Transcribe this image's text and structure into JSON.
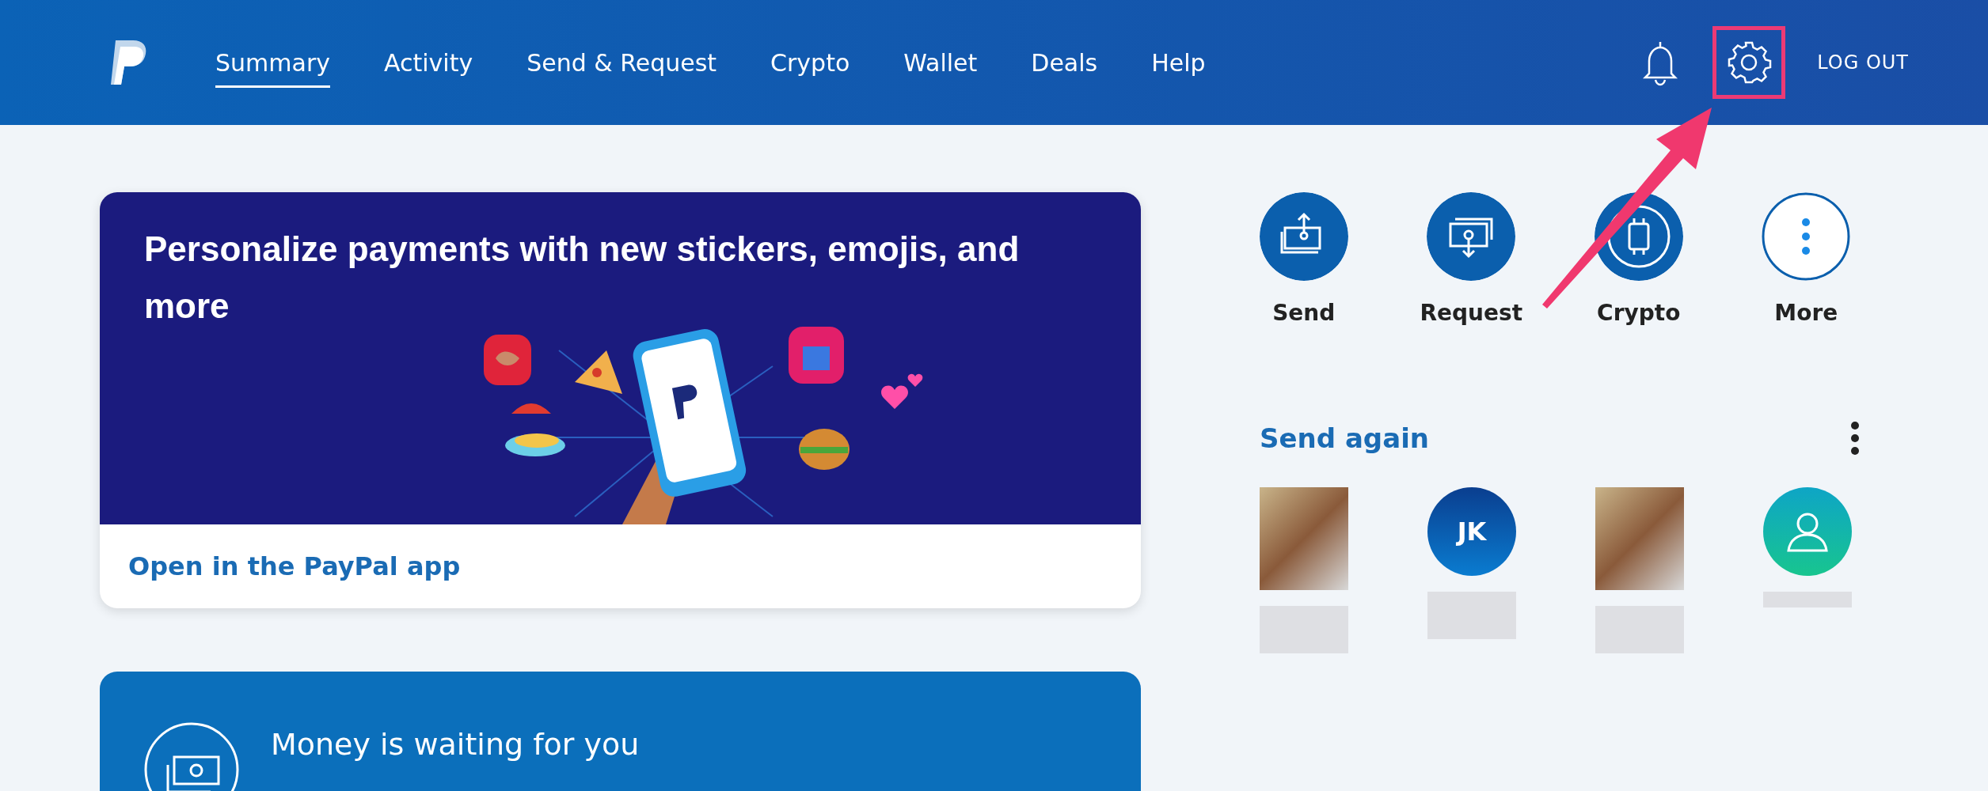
{
  "header": {
    "nav": [
      {
        "label": "Summary",
        "selected": true
      },
      {
        "label": "Activity",
        "selected": false
      },
      {
        "label": "Send & Request",
        "selected": false
      },
      {
        "label": "Crypto",
        "selected": false
      },
      {
        "label": "Wallet",
        "selected": false
      },
      {
        "label": "Deals",
        "selected": false
      },
      {
        "label": "Help",
        "selected": false
      }
    ],
    "settings_highlighted": true,
    "logout": "LOG OUT"
  },
  "promo_card": {
    "title": "Personalize payments with new stickers, emojis, and more",
    "link": "Open in the PayPal app"
  },
  "money_card": {
    "title": "Money is waiting for you"
  },
  "actions": [
    {
      "kind": "send",
      "label": "Send"
    },
    {
      "kind": "request",
      "label": "Request"
    },
    {
      "kind": "crypto",
      "label": "Crypto"
    },
    {
      "kind": "more",
      "label": "More"
    }
  ],
  "send_again": {
    "title": "Send again",
    "contacts": [
      {
        "kind": "photo"
      },
      {
        "kind": "initials",
        "initials": "JK"
      },
      {
        "kind": "photo"
      },
      {
        "kind": "generic"
      }
    ]
  }
}
